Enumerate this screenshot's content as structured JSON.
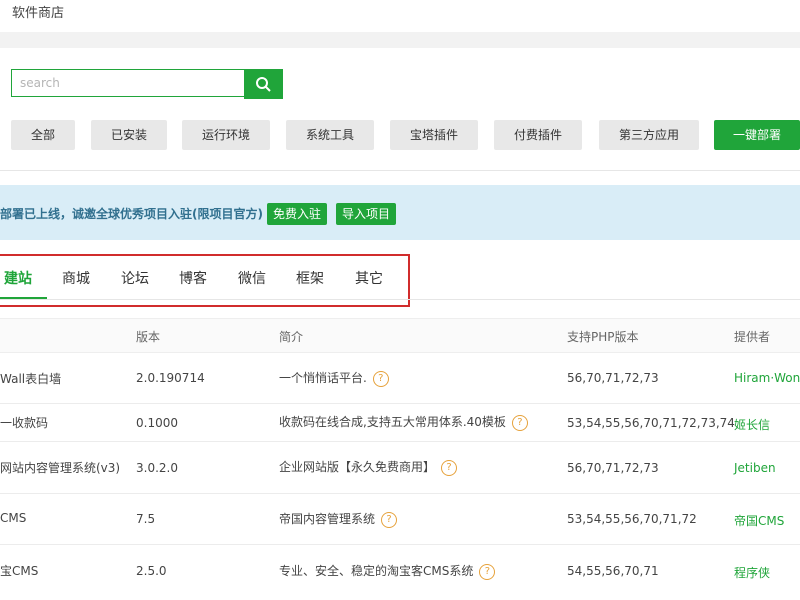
{
  "app": {
    "title": "软件商店"
  },
  "search": {
    "placeholder": "search"
  },
  "categories": [
    {
      "label": "全部"
    },
    {
      "label": "已安装"
    },
    {
      "label": "运行环境"
    },
    {
      "label": "系统工具"
    },
    {
      "label": "宝塔插件"
    },
    {
      "label": "付费插件"
    },
    {
      "label": "第三方应用"
    },
    {
      "label": "一键部署"
    }
  ],
  "notice": {
    "text": "部署已上线，诚邀全球优秀项目入驻(限项目官方)",
    "join_label": "免费入驻",
    "import_label": "导入项目"
  },
  "tabs": [
    {
      "label": "建站"
    },
    {
      "label": "商城"
    },
    {
      "label": "论坛"
    },
    {
      "label": "博客"
    },
    {
      "label": "微信"
    },
    {
      "label": "框架"
    },
    {
      "label": "其它"
    }
  ],
  "table": {
    "headers": [
      "版本",
      "简介",
      "支持PHP版本",
      "提供者"
    ],
    "rows": [
      {
        "name": "Wall表白墙",
        "version": "2.0.190714",
        "desc": "一个悄悄话平台.",
        "php": "56,70,71,72,73",
        "provider": "Hiram·Won"
      },
      {
        "name": "一收款码",
        "version": "0.1000",
        "desc": "收款码在线合成,支持五大常用体系.40模板",
        "php": "53,54,55,56,70,71,72,73,74",
        "provider": "姬长信"
      },
      {
        "name": "网站内容管理系统(v3)",
        "version": "3.0.2.0",
        "desc": "企业网站版【永久免费商用】",
        "php": "56,70,71,72,73",
        "provider": "Jetiben"
      },
      {
        "name": "CMS",
        "version": "7.5",
        "desc": "帝国内容管理系统",
        "php": "53,54,55,56,70,71,72",
        "provider": "帝国CMS"
      },
      {
        "name": "宝CMS",
        "version": "2.5.0",
        "desc": "专业、安全、稳定的淘宝客CMS系统",
        "php": "54,55,56,70,71",
        "provider": "程序侠"
      }
    ]
  },
  "colors": {
    "accent": "#20a53a",
    "notice_bg": "#d9edf7",
    "highlight_border": "#d12c2c"
  }
}
